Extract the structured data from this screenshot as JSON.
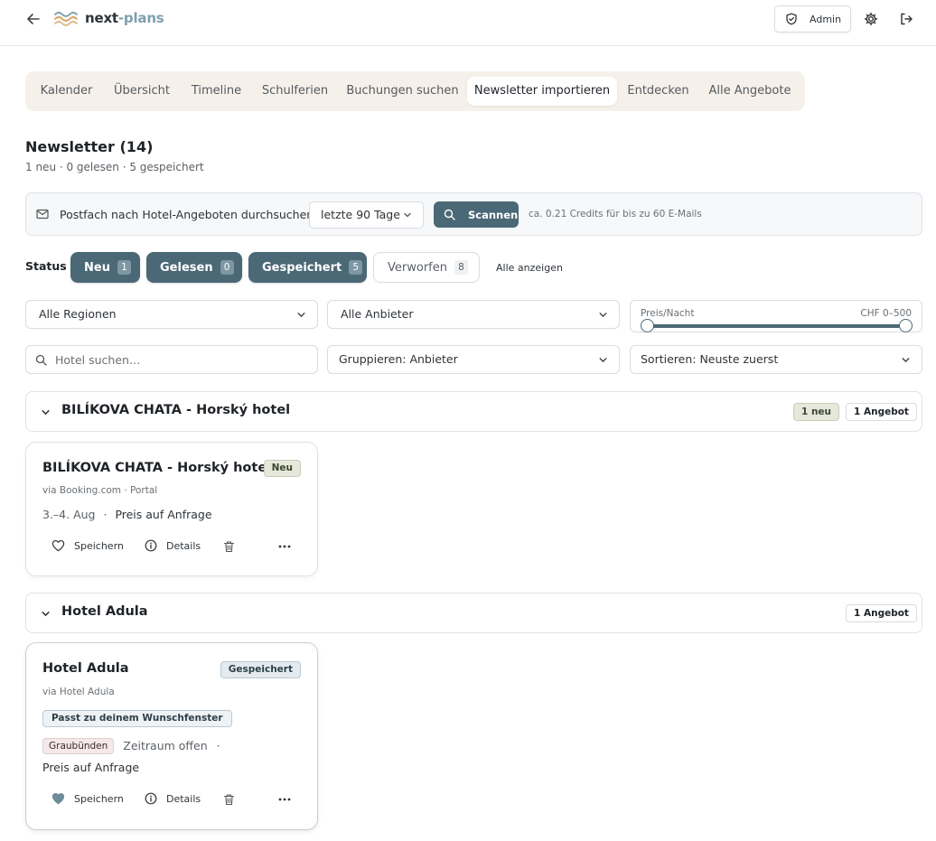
{
  "app": {
    "brand_main": "next",
    "brand_accent": "-plans",
    "admin_label": "Admin"
  },
  "tabs": [
    {
      "label": "Kalender"
    },
    {
      "label": "Übersicht"
    },
    {
      "label": "Timeline"
    },
    {
      "label": "Schulferien"
    },
    {
      "label": "Buchungen suchen"
    },
    {
      "label": "Newsletter importieren",
      "active": true
    },
    {
      "label": "Entdecken"
    },
    {
      "label": "Alle Angebote"
    }
  ],
  "page": {
    "title": "Newsletter (14)",
    "subtitle": "1 neu · 0 gelesen · 5 gespeichert"
  },
  "scan": {
    "label": "Postfach nach Hotel-Angeboten durchsuchen",
    "period": "letzte 90 Tage",
    "button": "Scannen",
    "credits": "ca. 0.21 Credits für bis zu 60 E-Mails"
  },
  "status": {
    "label": "Status",
    "filters": [
      {
        "label": "Neu",
        "count": "1",
        "active": true
      },
      {
        "label": "Gelesen",
        "count": "0",
        "active": true
      },
      {
        "label": "Gespeichert",
        "count": "5",
        "active": true
      },
      {
        "label": "Verworfen",
        "count": "8",
        "active": false
      }
    ],
    "show_all": "Alle anzeigen"
  },
  "filters": {
    "region": "Alle Regionen",
    "provider": "Alle Anbieter",
    "price_label": "Preis/Nacht",
    "price_range": "CHF 0–500",
    "price_min_fraction": 0,
    "price_max_fraction": 1,
    "search_placeholder": "Hotel suchen…",
    "group": "Gruppieren: Anbieter",
    "sort": "Sortieren: Neuste zuerst"
  },
  "groups": [
    {
      "title": "BILÍKOVA CHATA - Horský hotel",
      "new_badge": "1 neu",
      "count_badge": "1 Angebot",
      "card": {
        "title": "BILÍKOVA CHATA - Horský hotel",
        "badge": "Neu",
        "via": "via Booking.com · Portal",
        "dates": "3.–4. Aug",
        "sep": "·",
        "price": "Preis auf Anfrage",
        "save": "Speichern",
        "details": "Details"
      }
    },
    {
      "title": "Hotel Adula",
      "count_badge": "1 Angebot",
      "card": {
        "title": "Hotel Adula",
        "badge": "Gespeichert",
        "via": "via Hotel Adula",
        "match": "Passt zu deinem Wunschfenster",
        "region": "Graubünden",
        "period": "Zeitraum offen",
        "sep": "·",
        "price": "Preis auf Anfrage",
        "save": "Speichern",
        "details": "Details"
      }
    }
  ],
  "colors": {
    "accent": "#4b6877",
    "tab_bg": "#f5f1ea",
    "new_badge_bg": "#e5e8da",
    "saved_badge_bg": "#e3ebf0",
    "region_chip_bg": "#f4e8e8"
  },
  "icons": {
    "back": "arrow-left-icon",
    "logo": "wave-logo-icon",
    "admin": "shield-icon",
    "settings": "gear-icon",
    "logout": "logout-icon",
    "mail": "mail-icon",
    "search": "search-icon",
    "chevron": "chevron-down-icon",
    "heart": "heart-icon",
    "info": "info-icon",
    "trash": "trash-icon",
    "more": "more-horizontal-icon"
  }
}
